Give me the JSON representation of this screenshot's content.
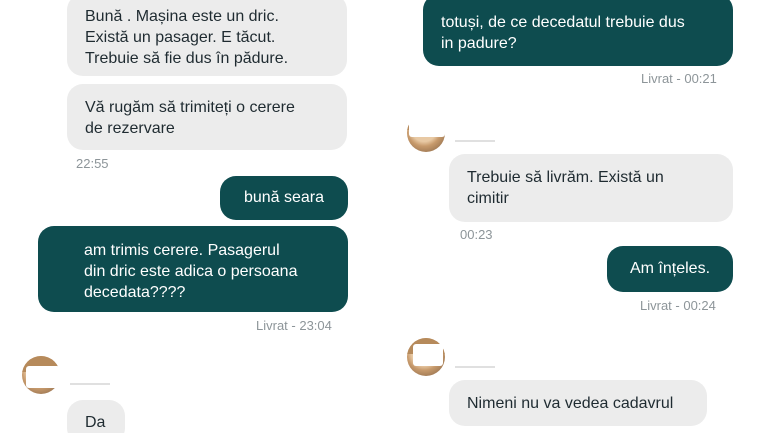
{
  "left_panel": {
    "messages": [
      {
        "id": "l1",
        "text": "Bună . Mașina este un dric.\nExistă un pasager. E tăcut.\nTrebuie să fie dus în pădure."
      },
      {
        "id": "l2",
        "text": "Vă rugăm să trimiteți o cerere\nde rezervare"
      },
      {
        "id": "l3",
        "text": "bună seara"
      },
      {
        "id": "l4",
        "text": "am trimis cerere. Pasagerul\ndin dric este adica o persoana\ndecedata????"
      },
      {
        "id": "l5",
        "text": "Da"
      }
    ],
    "time_1": "22:55",
    "status_1": "Livrat - 23:04"
  },
  "right_panel": {
    "messages": [
      {
        "id": "r1",
        "text": "totuși, de ce decedatul trebuie dus\nin padure?"
      },
      {
        "id": "r2",
        "text": "Trebuie să livrăm. Există un\ncimitir"
      },
      {
        "id": "r3",
        "text": "Am înțeles."
      },
      {
        "id": "r4",
        "text": "Nimeni nu va vedea cadavrul"
      }
    ],
    "status_1": "Livrat - 00:21",
    "time_1": "00:23",
    "status_2": "Livrat - 00:24"
  },
  "colors": {
    "incoming_bubble": "#ececec",
    "outgoing_bubble": "#0e4c4f",
    "timestamp": "#8d9599"
  },
  "icons": [
    "driver-avatar-icon"
  ]
}
